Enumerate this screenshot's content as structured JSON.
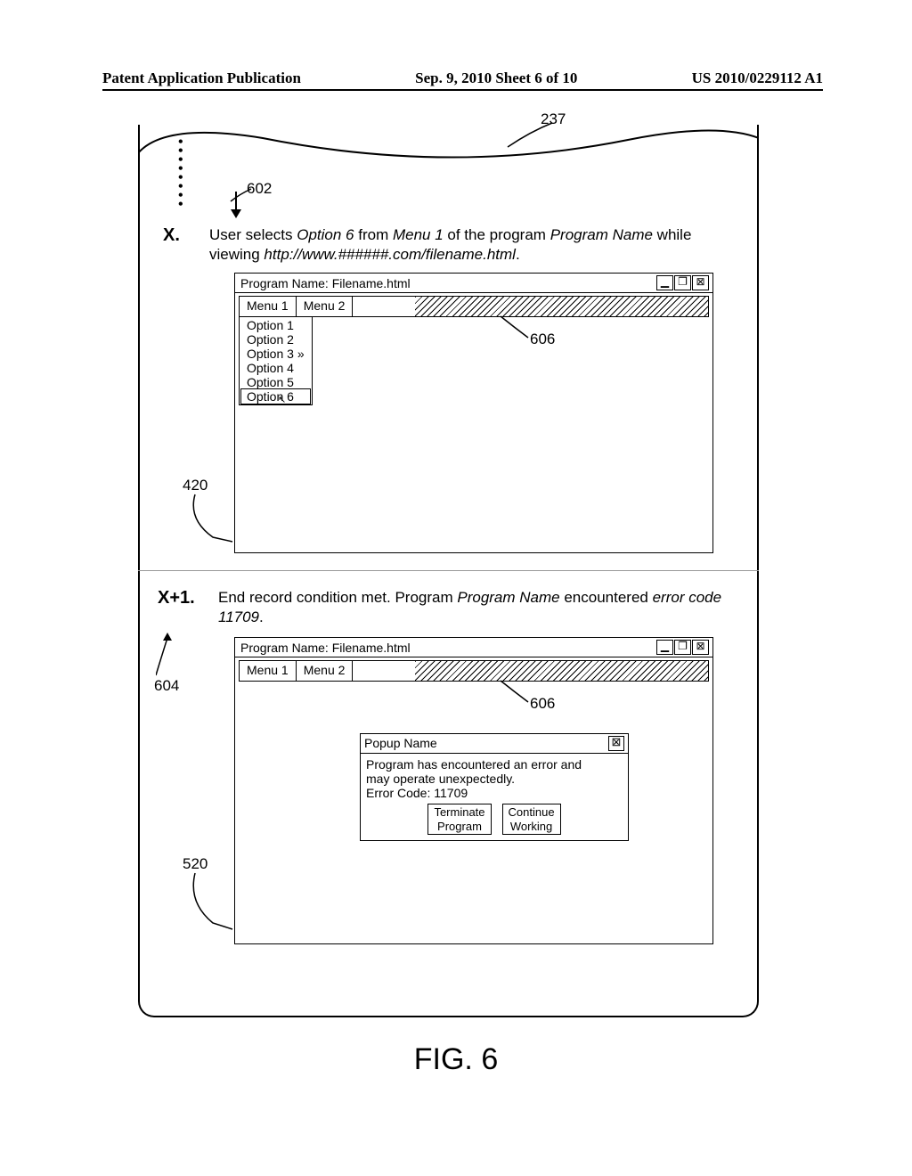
{
  "header": {
    "left": "Patent Application Publication",
    "center": "Sep. 9, 2010   Sheet 6 of 10",
    "right": "US 2010/0229112 A1"
  },
  "figure_label": "FIG. 6",
  "callouts": {
    "c237": "237",
    "c602": "602",
    "c420": "420",
    "c604": "604",
    "c520": "520",
    "c606a": "606",
    "c606b": "606"
  },
  "stepX": {
    "num": "X.",
    "prefix": "User selects ",
    "opt": "Option 6",
    "mid1": " from ",
    "menu": "Menu 1",
    "mid2": " of the program ",
    "prog": "Program Name",
    "mid3": " while viewing ",
    "url": "http://www.######.com/filename.html",
    "end": "."
  },
  "stepX1": {
    "num": "X+1.",
    "prefix": "End record condition met.  Program ",
    "prog": "Program Name",
    "mid": " encountered ",
    "err": "error code 11709",
    "end": "."
  },
  "window": {
    "title": "Program Name: Filename.html",
    "menu1": "Menu 1",
    "menu2": "Menu 2"
  },
  "win_icons": {
    "min": "▁",
    "max": "❐",
    "close": "⊠"
  },
  "dropdown": {
    "o1": "Option 1",
    "o2": "Option 2",
    "o3": "Option 3 »",
    "o4": "Option 4",
    "o5": "Option 5",
    "o6": "Option 6"
  },
  "popup": {
    "title": "Popup Name",
    "line1": "Program has encountered an error and",
    "line2": "may operate unexpectedly.",
    "line3": "Error Code: 11709",
    "btn1a": "Terminate",
    "btn1b": "Program",
    "btn2a": "Continue",
    "btn2b": "Working",
    "close": "⊠"
  }
}
